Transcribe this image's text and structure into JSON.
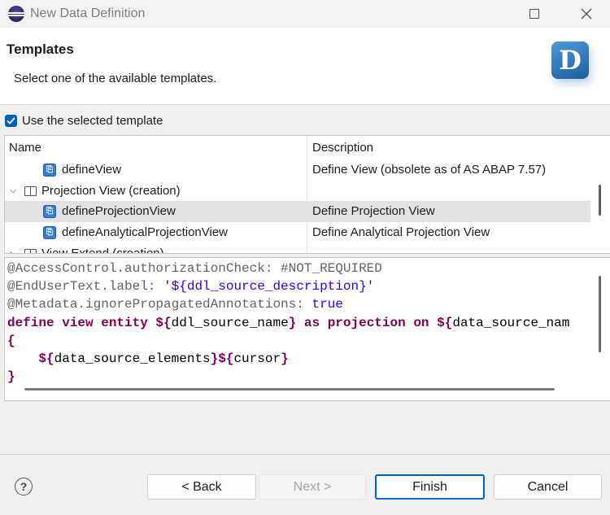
{
  "window": {
    "title": "New Data Definition"
  },
  "header": {
    "title": "Templates",
    "description": "Select one of the available templates."
  },
  "options": {
    "use_template_label": "Use the selected template",
    "use_template_checked": true
  },
  "table": {
    "columns": [
      "Name",
      "Description"
    ],
    "rows": [
      {
        "name": "defineView",
        "description": "Define View (obsolete as of AS ABAP 7.57)",
        "kind": "template",
        "selected": false
      },
      {
        "name": "Projection View (creation)",
        "description": "",
        "kind": "group",
        "expanded": true,
        "selected": false
      },
      {
        "name": "defineProjectionView",
        "description": "Define Projection View",
        "kind": "template",
        "selected": true
      },
      {
        "name": "defineAnalyticalProjectionView",
        "description": "Define Analytical Projection View",
        "kind": "template",
        "selected": false
      },
      {
        "name": "View Extend (creation)",
        "description": "",
        "kind": "group",
        "expanded": false,
        "selected": false
      }
    ]
  },
  "code": {
    "lines": [
      {
        "text": "@AccessControl.authorizationCheck: #NOT_REQUIRED"
      },
      {
        "text": "@EndUserText.label: '${ddl_source_description}'"
      },
      {
        "text": "@Metadata.ignorePropagatedAnnotations: true"
      },
      {
        "text": "define view entity ${ddl_source_name} as projection on ${data_source_nam"
      },
      {
        "text": "{"
      },
      {
        "text": "    ${data_source_elements}${cursor}"
      },
      {
        "text": "}"
      }
    ]
  },
  "buttons": {
    "back": "< Back",
    "next": "Next >",
    "finish": "Finish",
    "cancel": "Cancel",
    "help": "?"
  },
  "colors": {
    "accent": "#005fb8",
    "keyword": "#7f0055",
    "annotation": "#646464",
    "string": "#2a00ff",
    "selection": "#e2e2e2"
  },
  "icons": {
    "app": "eclipse-icon",
    "logo": "ddl-logo-icon",
    "template": "template-icon",
    "group": "book-icon"
  }
}
